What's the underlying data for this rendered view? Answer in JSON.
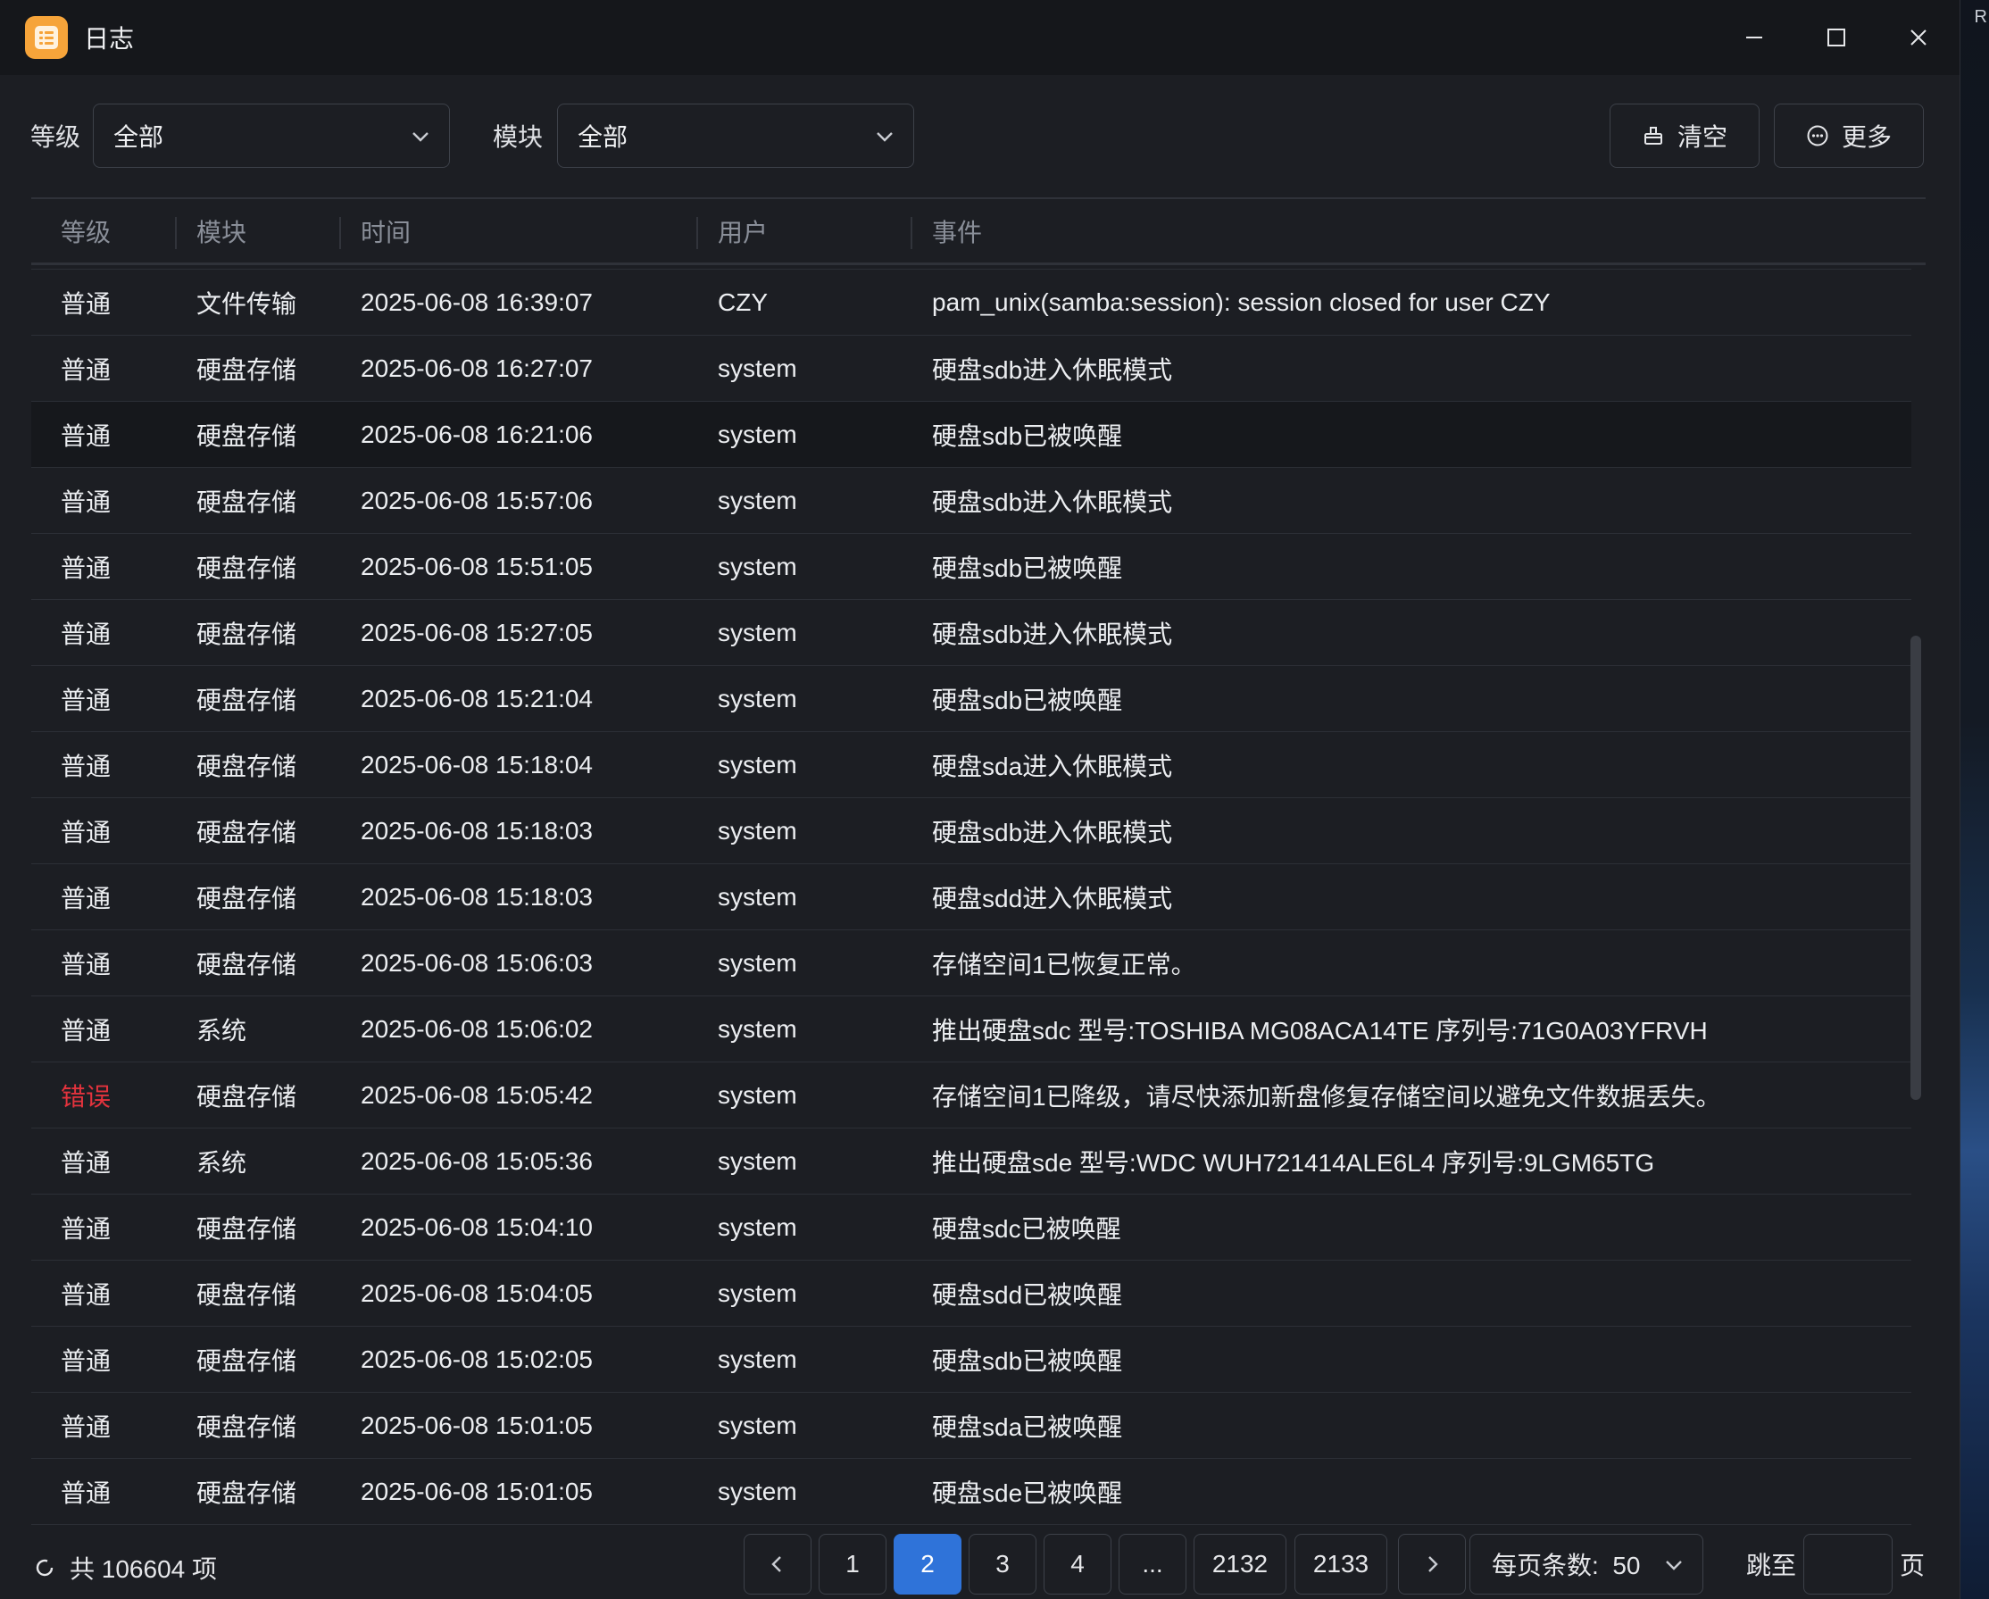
{
  "window": {
    "title": "日志"
  },
  "filters": {
    "level_label": "等级",
    "level_value": "全部",
    "module_label": "模块",
    "module_value": "全部",
    "clear_label": "清空",
    "more_label": "更多"
  },
  "table": {
    "columns": [
      "等级",
      "模块",
      "时间",
      "用户",
      "事件"
    ],
    "rows": [
      {
        "level": "普通",
        "module": "文件传输",
        "time": "2025-06-08 16:39:07",
        "user": "CZY",
        "event": "pam_unix(samba:session): session closed for user CZY"
      },
      {
        "level": "普通",
        "module": "硬盘存储",
        "time": "2025-06-08 16:27:07",
        "user": "system",
        "event": "硬盘sdb进入休眠模式"
      },
      {
        "level": "普通",
        "module": "硬盘存储",
        "time": "2025-06-08 16:21:06",
        "user": "system",
        "event": "硬盘sdb已被唤醒"
      },
      {
        "level": "普通",
        "module": "硬盘存储",
        "time": "2025-06-08 15:57:06",
        "user": "system",
        "event": "硬盘sdb进入休眠模式"
      },
      {
        "level": "普通",
        "module": "硬盘存储",
        "time": "2025-06-08 15:51:05",
        "user": "system",
        "event": "硬盘sdb已被唤醒"
      },
      {
        "level": "普通",
        "module": "硬盘存储",
        "time": "2025-06-08 15:27:05",
        "user": "system",
        "event": "硬盘sdb进入休眠模式"
      },
      {
        "level": "普通",
        "module": "硬盘存储",
        "time": "2025-06-08 15:21:04",
        "user": "system",
        "event": "硬盘sdb已被唤醒"
      },
      {
        "level": "普通",
        "module": "硬盘存储",
        "time": "2025-06-08 15:18:04",
        "user": "system",
        "event": "硬盘sda进入休眠模式"
      },
      {
        "level": "普通",
        "module": "硬盘存储",
        "time": "2025-06-08 15:18:03",
        "user": "system",
        "event": "硬盘sdb进入休眠模式"
      },
      {
        "level": "普通",
        "module": "硬盘存储",
        "time": "2025-06-08 15:18:03",
        "user": "system",
        "event": "硬盘sdd进入休眠模式"
      },
      {
        "level": "普通",
        "module": "硬盘存储",
        "time": "2025-06-08 15:06:03",
        "user": "system",
        "event": "存储空间1已恢复正常。"
      },
      {
        "level": "普通",
        "module": "系统",
        "time": "2025-06-08 15:06:02",
        "user": "system",
        "event": "推出硬盘sdc 型号:TOSHIBA MG08ACA14TE 序列号:71G0A03YFRVH"
      },
      {
        "level": "错误",
        "module": "硬盘存储",
        "time": "2025-06-08 15:05:42",
        "user": "system",
        "event": "存储空间1已降级，请尽快添加新盘修复存储空间以避免文件数据丢失。"
      },
      {
        "level": "普通",
        "module": "系统",
        "time": "2025-06-08 15:05:36",
        "user": "system",
        "event": "推出硬盘sde 型号:WDC WUH721414ALE6L4 序列号:9LGM65TG"
      },
      {
        "level": "普通",
        "module": "硬盘存储",
        "time": "2025-06-08 15:04:10",
        "user": "system",
        "event": "硬盘sdc已被唤醒"
      },
      {
        "level": "普通",
        "module": "硬盘存储",
        "time": "2025-06-08 15:04:05",
        "user": "system",
        "event": "硬盘sdd已被唤醒"
      },
      {
        "level": "普通",
        "module": "硬盘存储",
        "time": "2025-06-08 15:02:05",
        "user": "system",
        "event": "硬盘sdb已被唤醒"
      },
      {
        "level": "普通",
        "module": "硬盘存储",
        "time": "2025-06-08 15:01:05",
        "user": "system",
        "event": "硬盘sda已被唤醒"
      },
      {
        "level": "普通",
        "module": "硬盘存储",
        "time": "2025-06-08 15:01:05",
        "user": "system",
        "event": "硬盘sde已被唤醒"
      }
    ]
  },
  "footer": {
    "total_text": "共 106604 项",
    "pages": [
      "1",
      "2",
      "3",
      "4",
      "...",
      "2132",
      "2133"
    ],
    "current_page": "2",
    "per_page_text": "每页条数:  50",
    "jump_label": "跳至",
    "page_suffix": "页"
  },
  "desktop": {
    "corner_text": "R"
  },
  "colors": {
    "accent": "#2f73d9",
    "error": "#e3333d",
    "app_icon": "#f6a43a"
  }
}
